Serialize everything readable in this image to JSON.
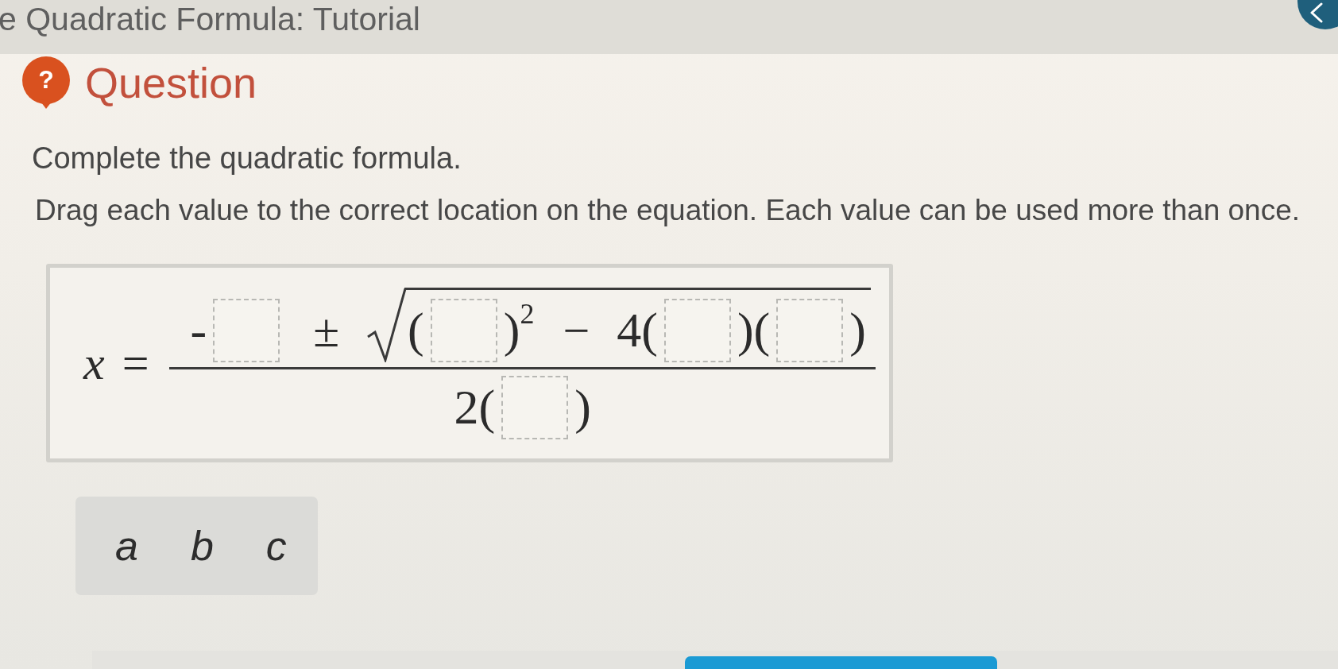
{
  "header": {
    "title": "e Quadratic Formula: Tutorial"
  },
  "question": {
    "icon_text": "?",
    "heading": "Question",
    "prompt": "Complete the quadratic formula.",
    "instructions": "Drag each value to the correct location on the equation. Each value can be used more than once."
  },
  "formula": {
    "variable": "x",
    "equals": "=",
    "numerator": [
      {
        "kind": "text",
        "text": "-"
      },
      {
        "kind": "slot"
      },
      {
        "kind": "op",
        "text": "±"
      },
      {
        "kind": "radical",
        "children": [
          {
            "kind": "text",
            "text": "("
          },
          {
            "kind": "slot"
          },
          {
            "kind": "text",
            "text": ")"
          },
          {
            "kind": "sup",
            "text": "2"
          },
          {
            "kind": "op",
            "text": "−"
          },
          {
            "kind": "text",
            "text": "4("
          },
          {
            "kind": "slot"
          },
          {
            "kind": "text",
            "text": ")("
          },
          {
            "kind": "slot"
          },
          {
            "kind": "text",
            "text": ")"
          }
        ]
      }
    ],
    "denominator": [
      {
        "kind": "text",
        "text": "2("
      },
      {
        "kind": "slot"
      },
      {
        "kind": "text",
        "text": ")"
      }
    ]
  },
  "values": [
    "a",
    "b",
    "c"
  ]
}
